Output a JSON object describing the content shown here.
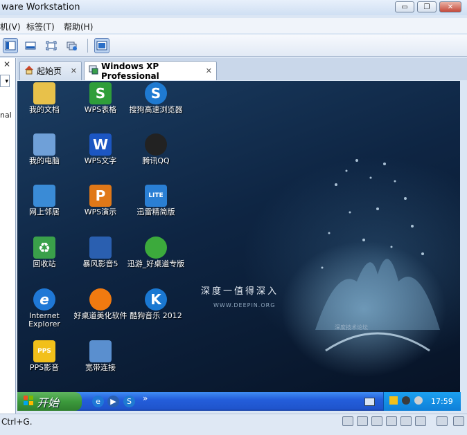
{
  "window": {
    "title": "ware Workstation",
    "minimize_glyph": "▭",
    "restore_glyph": "❐",
    "close_glyph": "✕"
  },
  "menu": [
    "机(V)",
    "标签(T)",
    "帮助(H)"
  ],
  "toolbar_icons": [
    "view-sidebar-icon",
    "view-console-icon",
    "fullscreen-icon",
    "snapshot-manager-icon",
    "unity-icon"
  ],
  "library": {
    "close_glyph": "✕",
    "dropdown_glyph": "▾",
    "truncated_text": "nal"
  },
  "tabs": [
    {
      "label": "起始页",
      "icon": "home-icon",
      "close": "✕"
    },
    {
      "label": "Windows XP Professional",
      "icon": "vm-icon",
      "close": "✕"
    }
  ],
  "desktop": {
    "wallpaper_title": "深度一值得深入",
    "wallpaper_url": "WWW.DEEPIN.ORG",
    "wallpaper_forum": "深度技术论坛",
    "icons": [
      {
        "label": "我的文档",
        "icon": "my-documents-icon",
        "color": "#e8c14a"
      },
      {
        "label": "WPS表格",
        "icon": "wps-spreadsheet-icon",
        "color": "#2f9e3a",
        "glyph": "S"
      },
      {
        "label": "搜狗高速浏览器",
        "icon": "sogou-browser-icon",
        "color": "#1f7ad1",
        "glyph": "S"
      },
      {
        "label": "我的电脑",
        "icon": "my-computer-icon",
        "color": "#6fa0d8"
      },
      {
        "label": "WPS文字",
        "icon": "wps-writer-icon",
        "color": "#1c56c2",
        "glyph": "W"
      },
      {
        "label": "腾讯QQ",
        "icon": "qq-icon",
        "color": "#222222"
      },
      {
        "label": "网上邻居",
        "icon": "network-places-icon",
        "color": "#3a8bd6"
      },
      {
        "label": "WPS演示",
        "icon": "wps-presentation-icon",
        "color": "#e07818",
        "glyph": "P"
      },
      {
        "label": "迅雷精简版",
        "icon": "thunder-lite-icon",
        "color": "#2a7fd4",
        "glyph": "LITE"
      },
      {
        "label": "回收站",
        "icon": "recycle-bin-icon",
        "color": "#3aa04a",
        "glyph": "♻"
      },
      {
        "label": "暴风影音5",
        "icon": "baofeng-icon",
        "color": "#2a5fb0"
      },
      {
        "label": "迅游_好桌道专版",
        "icon": "xunyou-icon",
        "color": "#3caa3c"
      },
      {
        "label": "Internet Explorer",
        "icon": "internet-explorer-icon",
        "color": "#1f78d6",
        "glyph": "e"
      },
      {
        "label": "好桌道美化软件",
        "icon": "haozhuodao-icon",
        "color": "#f07a10"
      },
      {
        "label": "酷狗音乐 2012",
        "icon": "kugou-icon",
        "color": "#1a78d2",
        "glyph": "K"
      },
      {
        "label": "PPS影音",
        "icon": "pps-icon",
        "color": "#f2c01a",
        "glyph": "PPS"
      },
      {
        "label": "宽带连接",
        "icon": "broadband-icon",
        "color": "#5a8fcf"
      }
    ]
  },
  "taskbar": {
    "start_label": "开始",
    "quicklaunch": [
      "ie-quicklaunch-icon",
      "media-player-icon",
      "sogou-quicklaunch-icon"
    ],
    "more_glyph": "»",
    "clock": "17:59"
  },
  "statusbar": {
    "hint": "Ctrl+G.",
    "icons": [
      "hard-disk-icon",
      "network-icon",
      "floppy-icon",
      "usb-icon",
      "printer-icon",
      "sound-icon",
      "message-icon",
      "stretch-icon"
    ]
  }
}
